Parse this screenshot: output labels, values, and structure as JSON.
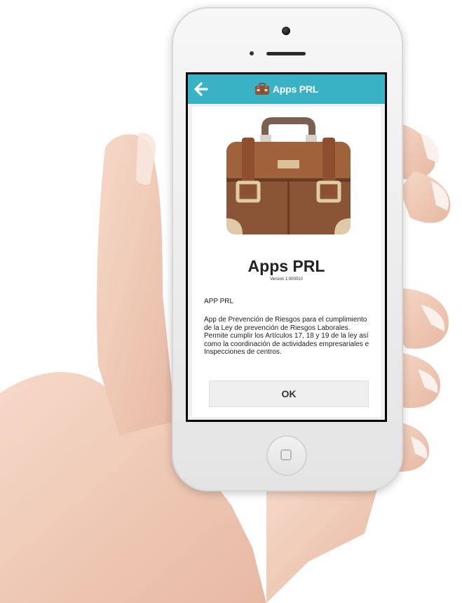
{
  "appbar": {
    "back_icon": "arrow-left-icon",
    "title_icon": "briefcase-icon",
    "title": "Apps PRL",
    "color": "#3ab2c6"
  },
  "about": {
    "hero_icon": "briefcase-icon",
    "app_name": "Apps PRL",
    "version": "Version 1.000010",
    "desc_title": "APP PRL",
    "description": "App de Prevención de Riesgos para el cumplimiento de la Ley de prevención de Riesgos Laborales. Permite cumplir los Artículos 17, 18 y 19 de la ley así como la coordinación de actividades empresariales e Inspecciones de centros.",
    "ok_label": "OK"
  }
}
